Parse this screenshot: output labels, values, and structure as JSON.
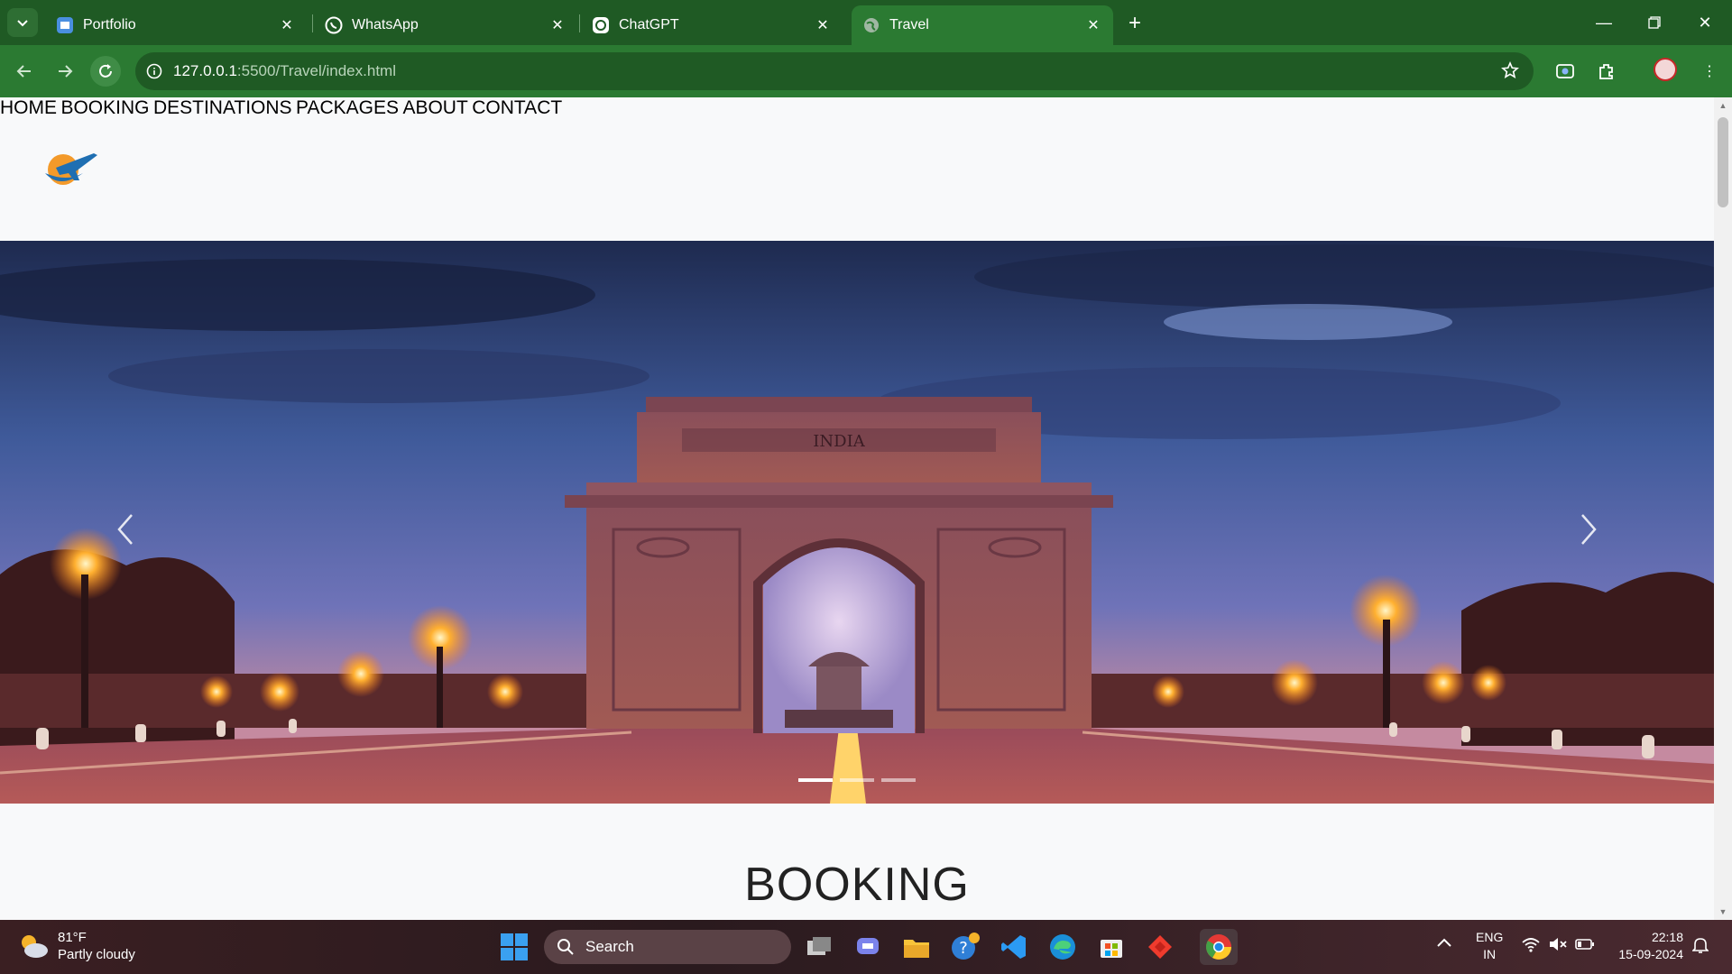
{
  "browser": {
    "tabs": [
      {
        "title": "Portfolio",
        "icon": "portfolio-favicon"
      },
      {
        "title": "WhatsApp",
        "icon": "whatsapp-icon"
      },
      {
        "title": "ChatGPT",
        "icon": "chatgpt-icon"
      },
      {
        "title": "Travel",
        "icon": "globe-icon",
        "active": true
      }
    ],
    "url_host": "127.0.0.1",
    "url_path": ":5500/Travel/index.html"
  },
  "site": {
    "nav": [
      "HOME",
      "BOOKING",
      "DESTINATIONS",
      "PACKAGES",
      "ABOUT",
      "CONTACT"
    ],
    "carousel": {
      "slides": 3,
      "active_slide": 1
    },
    "booking_heading": "BOOKING",
    "monument_text": "INDIA"
  },
  "taskbar": {
    "weather_temp": "81°F",
    "weather_desc": "Partly cloudy",
    "search_placeholder": "Search",
    "lang_primary": "ENG",
    "lang_secondary": "IN",
    "time": "22:18",
    "date": "15-09-2024"
  },
  "colors": {
    "chrome_dark": "#1f5a24",
    "chrome_toolbar": "#2b7a32",
    "page_bg": "#f8f9fa"
  }
}
